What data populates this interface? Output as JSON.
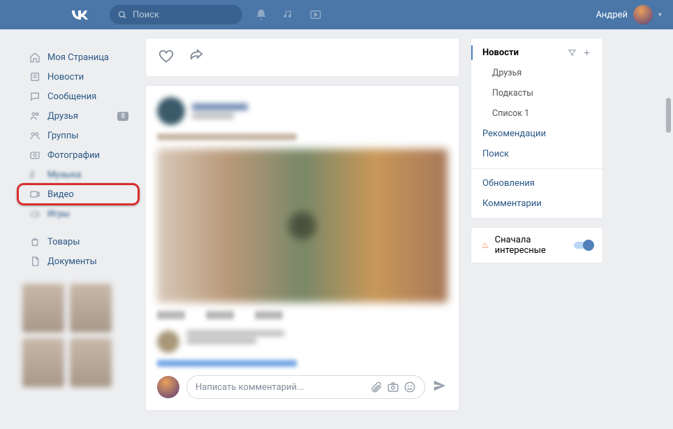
{
  "header": {
    "search_placeholder": "Поиск",
    "username": "Андрей"
  },
  "nav": {
    "items": [
      {
        "label": "Моя Страница",
        "icon": "home"
      },
      {
        "label": "Новости",
        "icon": "news"
      },
      {
        "label": "Сообщения",
        "icon": "messages"
      },
      {
        "label": "Друзья",
        "icon": "friends",
        "badge": "8"
      },
      {
        "label": "Группы",
        "icon": "groups"
      },
      {
        "label": "Фотографии",
        "icon": "photos"
      },
      {
        "label": "Музыка",
        "icon": "music",
        "blurred": true
      },
      {
        "label": "Видео",
        "icon": "video",
        "highlighted": true
      },
      {
        "label": "Игры",
        "icon": "games",
        "blurred": true
      },
      {
        "label": "Товары",
        "icon": "market",
        "gap": true
      },
      {
        "label": "Документы",
        "icon": "docs"
      }
    ]
  },
  "comment": {
    "placeholder": "Написать комментарий..."
  },
  "sidebar": {
    "sections": {
      "news": "Новости",
      "friends": "Друзья",
      "podcasts": "Подкасты",
      "list1": "Список 1",
      "recommendations": "Рекомендации",
      "search": "Поиск",
      "updates": "Обновления",
      "comments": "Комментарии"
    },
    "toggle_label": "Сначала интересные"
  }
}
